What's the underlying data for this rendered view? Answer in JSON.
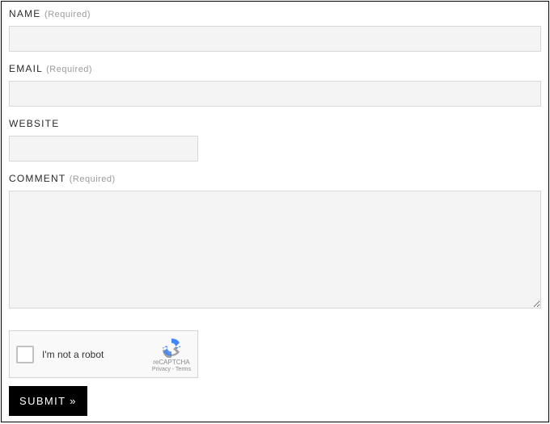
{
  "fields": {
    "name": {
      "label": "NAME",
      "required": "(Required)"
    },
    "email": {
      "label": "EMAIL",
      "required": "(Required)"
    },
    "website": {
      "label": "WEBSITE"
    },
    "comment": {
      "label": "COMMENT",
      "required": "(Required)"
    }
  },
  "captcha": {
    "checkbox_label": "I'm not a robot",
    "brand": "reCAPTCHA",
    "links": "Privacy - Terms"
  },
  "submit_label": "SUBMIT »"
}
